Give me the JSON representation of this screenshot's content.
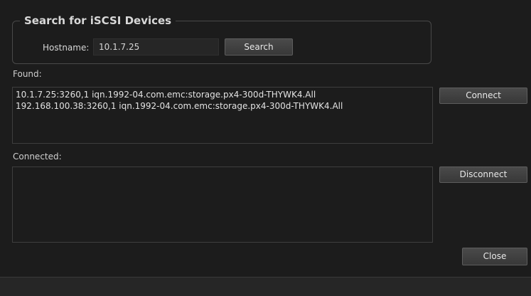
{
  "search_group": {
    "title": "Search for iSCSI Devices",
    "hostname_label": "Hostname:",
    "hostname_value": "10.1.7.25",
    "search_button": "Search"
  },
  "found": {
    "label": "Found:",
    "items": [
      "10.1.7.25:3260,1 iqn.1992-04.com.emc:storage.px4-300d-THYWK4.All",
      "192.168.100.38:3260,1 iqn.1992-04.com.emc:storage.px4-300d-THYWK4.All"
    ],
    "connect_button": "Connect"
  },
  "connected": {
    "label": "Connected:",
    "items": [],
    "disconnect_button": "Disconnect"
  },
  "dialog": {
    "close_button": "Close"
  }
}
